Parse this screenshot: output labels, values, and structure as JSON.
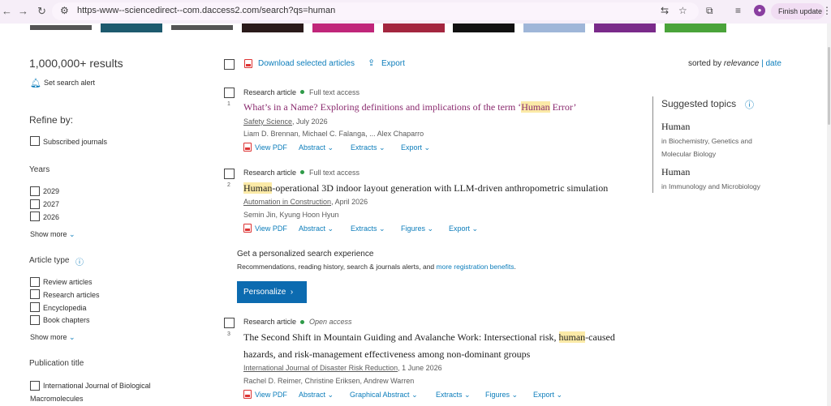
{
  "browser": {
    "url": "https-www--sciencedirect--com.daccess2.com/search?qs=human",
    "finish_update": "Finish update",
    "icons": [
      "back-icon",
      "forward-icon",
      "reload-icon",
      "site-settings-icon",
      "translate-icon",
      "star-icon",
      "extensions-icon",
      "reading-list-icon",
      "profile-icon",
      "menu-icon"
    ]
  },
  "left": {
    "results_count": "1,000,000+ results",
    "set_alert": "Set search alert",
    "refine_by": "Refine by:",
    "subscribed": "Subscribed journals",
    "years_heading": "Years",
    "years": [
      "2029",
      "2027",
      "2026"
    ],
    "years_show_more": "Show more",
    "article_type_heading": "Article type",
    "article_types": [
      "Review articles",
      "Research articles",
      "Encyclopedia",
      "Book chapters"
    ],
    "types_show_more": "Show more",
    "publication_heading": "Publication title",
    "publication_item_line1": "International Journal of Biological",
    "publication_item_line2": "Macromolecules"
  },
  "toolbar": {
    "download": "Download selected articles",
    "export": "Export",
    "sorted_by": "sorted by",
    "relevance": "relevance",
    "sep": "|",
    "date": "date"
  },
  "results": [
    {
      "num": "1",
      "type": "Research article",
      "access": "Full text access",
      "title_pre": "What’s in a Name? Exploring definitions and implications of the term ‘",
      "title_hl": "Human",
      "title_post": " Error’",
      "journal": "Safety Science",
      "date": ", July 2026",
      "authors": "Liam D. Brennan, Michael C. Falanga, ... Alex Chaparro",
      "actions": [
        "View PDF",
        "Abstract",
        "Extracts",
        "Export"
      ]
    },
    {
      "num": "2",
      "type": "Research article",
      "access": "Full text access",
      "title_hl": "Human",
      "title_post": "-operational 3D indoor layout generation with LLM-driven anthropometric simulation",
      "journal": "Automation in Construction",
      "date": ", April 2026",
      "authors": "Semin Jin, Kyung Hoon Hyun",
      "actions": [
        "View PDF",
        "Abstract",
        "Extracts",
        "Figures",
        "Export"
      ]
    },
    {
      "num": "3",
      "type": "Research article",
      "access": "Open access",
      "title_line1_pre": "The Second Shift in Mountain Guiding and Avalanche Work: Intersectional risk, ",
      "title_line1_hl": "human",
      "title_line1_post": "-caused",
      "title_line2": "hazards, and risk-management effectiveness among non-dominant groups",
      "journal": "International Journal of Disaster Risk Reduction",
      "date": ", 1 June 2026",
      "authors": "Rachel D. Reimer, Christine Eriksen, Andrew Warren",
      "actions": [
        "View PDF",
        "Abstract",
        "Graphical Abstract",
        "Extracts",
        "Figures",
        "Export"
      ]
    }
  ],
  "promo": {
    "heading": "Get a personalized search experience",
    "text": "Recommendations, reading history, search & journals alerts, and ",
    "link": "more registration benefits",
    "end": ".",
    "button": "Personalize",
    "button_arrow": "›"
  },
  "suggested": {
    "heading": "Suggested topics",
    "topics": [
      {
        "name": "Human",
        "in_line1": "in Biochemistry, Genetics and",
        "in_line2": "Molecular Biology"
      },
      {
        "name": "Human",
        "in_line1": "in Immunology and Microbiology"
      }
    ]
  },
  "colors": {
    "link": "#0c7dbb",
    "title_visited": "#8a2a6e",
    "highlight": "#fbeaa7",
    "button": "#0c6bb0",
    "access_dot": "#2e9a48"
  }
}
